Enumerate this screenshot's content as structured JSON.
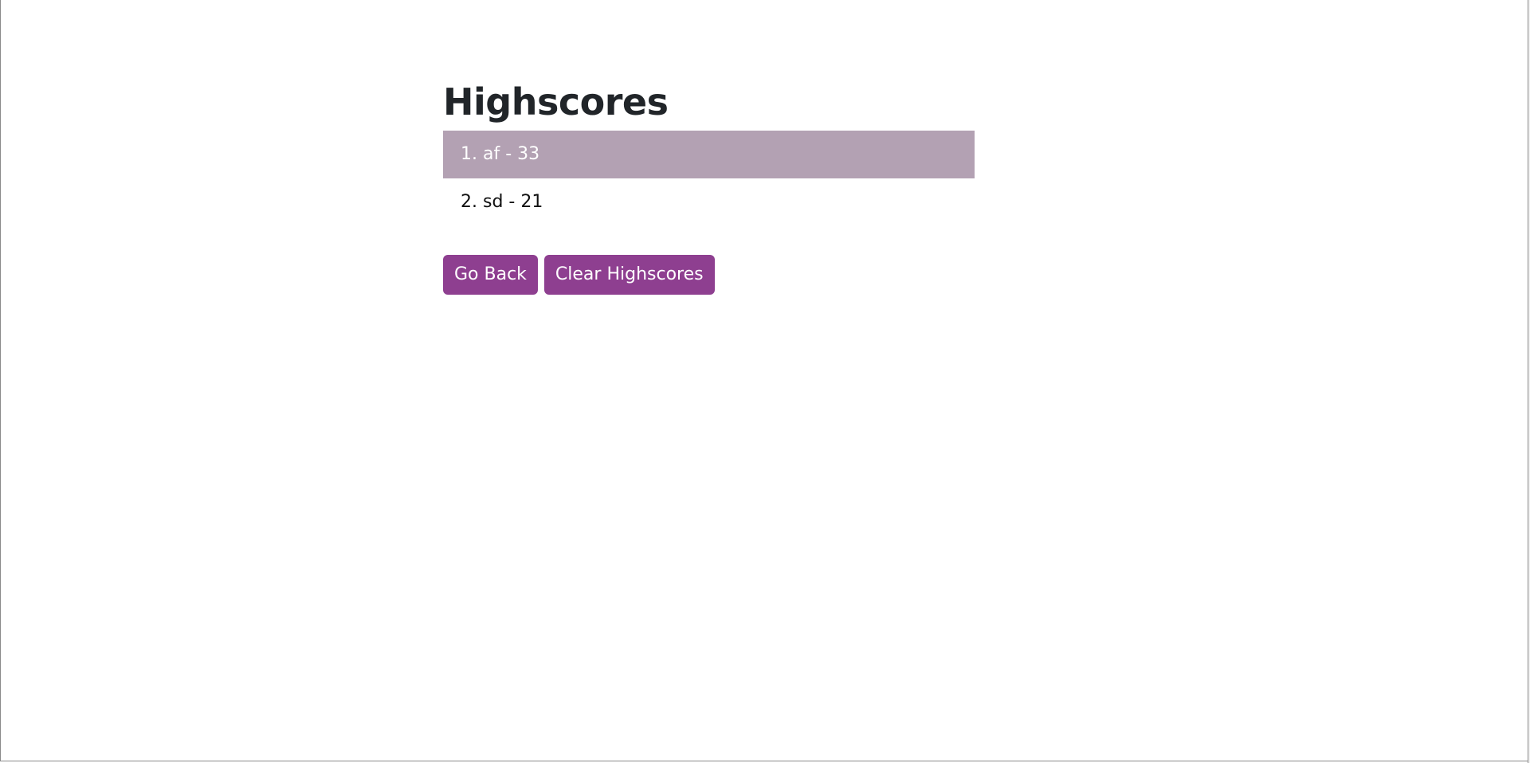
{
  "page": {
    "title": "Highscores"
  },
  "highscores": {
    "items": [
      {
        "text": "1. af - 33"
      },
      {
        "text": "2. sd - 21"
      }
    ]
  },
  "actions": {
    "go_back_label": "Go Back",
    "clear_label": "Clear Highscores"
  },
  "colors": {
    "accent": "#8e3f90",
    "highlight_row": "#b3a1b3",
    "heading_text": "#212529"
  }
}
